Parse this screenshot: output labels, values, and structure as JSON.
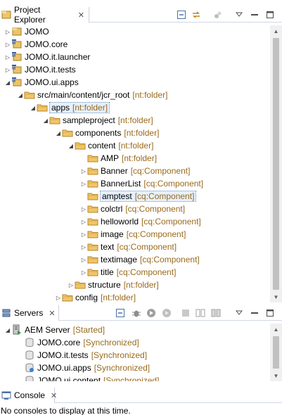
{
  "project_explorer": {
    "tab_title": "Project Explorer",
    "close_glyph": "⊠",
    "toolbar_icons": [
      "collapse-all-icon",
      "link-with-editor-icon",
      "focus-icon",
      "view-menu-icon",
      "minimize-icon",
      "maximize-icon"
    ],
    "tree": [
      {
        "label": "JOMO",
        "decoration": "",
        "twisty": "collapsed",
        "icon": "project-icon"
      },
      {
        "label": "JOMO.core",
        "decoration": "",
        "twisty": "collapsed",
        "icon": "maven-project-icon"
      },
      {
        "label": "JOMO.it.launcher",
        "decoration": "",
        "twisty": "collapsed",
        "icon": "maven-project-icon"
      },
      {
        "label": "JOMO.it.tests",
        "decoration": "",
        "twisty": "collapsed",
        "icon": "maven-project-icon"
      },
      {
        "label": "JOMO.ui.apps",
        "decoration": "",
        "twisty": "expanded",
        "icon": "maven-project-icon"
      },
      {
        "label": "src/main/content/jcr_root",
        "decoration": "[nt:folder]",
        "twisty": "expanded",
        "icon": "folder-icon"
      },
      {
        "label": "apps",
        "decoration": "[nt:folder]",
        "twisty": "expanded",
        "icon": "folder-icon",
        "selected": true
      },
      {
        "label": "sampleproject",
        "decoration": "[nt:folder]",
        "twisty": "expanded",
        "icon": "folder-icon"
      },
      {
        "label": "components",
        "decoration": "[nt:folder]",
        "twisty": "expanded",
        "icon": "folder-icon"
      },
      {
        "label": "content",
        "decoration": "[nt:folder]",
        "twisty": "expanded",
        "icon": "folder-icon"
      },
      {
        "label": "AMP",
        "decoration": "[nt:folder]",
        "twisty": "none",
        "icon": "folder-icon"
      },
      {
        "label": "Banner",
        "decoration": "[cq:Component]",
        "twisty": "collapsed",
        "icon": "folder-icon"
      },
      {
        "label": "BannerList",
        "decoration": "[cq:Component]",
        "twisty": "collapsed",
        "icon": "folder-icon"
      },
      {
        "label": "amptest",
        "decoration": "[cq:Component]",
        "twisty": "none",
        "icon": "folder-icon",
        "selected": true
      },
      {
        "label": "colctrl",
        "decoration": "[cq:Component]",
        "twisty": "collapsed",
        "icon": "folder-icon"
      },
      {
        "label": "helloworld",
        "decoration": "[cq:Component]",
        "twisty": "collapsed",
        "icon": "folder-icon"
      },
      {
        "label": "image",
        "decoration": "[cq:Component]",
        "twisty": "collapsed",
        "icon": "folder-icon"
      },
      {
        "label": "text",
        "decoration": "[cq:Component]",
        "twisty": "collapsed",
        "icon": "folder-icon"
      },
      {
        "label": "textimage",
        "decoration": "[cq:Component]",
        "twisty": "collapsed",
        "icon": "folder-icon"
      },
      {
        "label": "title",
        "decoration": "[cq:Component]",
        "twisty": "collapsed",
        "icon": "folder-icon"
      },
      {
        "label": "structure",
        "decoration": "[nt:folder]",
        "twisty": "collapsed",
        "icon": "folder-icon"
      },
      {
        "label": "config",
        "decoration": "[nt:folder]",
        "twisty": "collapsed",
        "icon": "folder-icon"
      }
    ]
  },
  "servers": {
    "tab_title": "Servers",
    "close_glyph": "⊠",
    "toolbar_icons": [
      "collapse-icon",
      "debug-icon",
      "start-icon",
      "profile-icon",
      "stop-icon",
      "publish-icon",
      "clean-icon",
      "view-menu-icon",
      "minimize-icon",
      "maximize-icon"
    ],
    "tree": [
      {
        "label": "AEM Server",
        "decoration": "[Started]",
        "twisty": "expanded",
        "icon": "server-icon"
      },
      {
        "label": "JOMO.core",
        "decoration": "[Synchronized]",
        "twisty": "none",
        "icon": "module-icon"
      },
      {
        "label": "JOMO.it.tests",
        "decoration": "[Synchronized]",
        "twisty": "none",
        "icon": "module-icon"
      },
      {
        "label": "JOMO.ui.apps",
        "decoration": "[Synchronized]",
        "twisty": "none",
        "icon": "module-content-icon"
      },
      {
        "label": "JOMO.ui.content",
        "decoration": "[Synchronized]",
        "twisty": "none",
        "icon": "module-icon"
      }
    ]
  },
  "console": {
    "tab_title": "Console",
    "message": "No consoles to display at this time."
  }
}
